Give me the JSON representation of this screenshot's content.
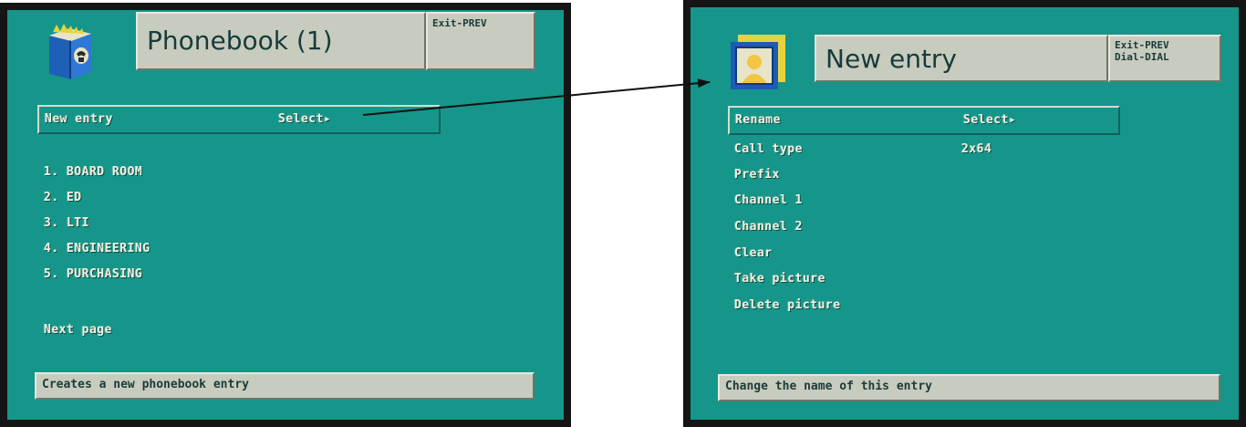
{
  "left_screen": {
    "title": "Phonebook (1)",
    "keys": [
      "Exit-PREV"
    ],
    "selected_item": {
      "label": "New entry",
      "action": "Select▸"
    },
    "entries": [
      "1. BOARD ROOM",
      "2. ED",
      "3. LTI",
      "4. ENGINEERING",
      "5. PURCHASING"
    ],
    "next_page": "Next page",
    "status": "Creates a new phonebook entry"
  },
  "right_screen": {
    "title": "New entry",
    "keys": [
      "Exit-PREV",
      "Dial-DIAL"
    ],
    "items": [
      {
        "label": "Rename",
        "value": "Select▸"
      },
      {
        "label": "Call type",
        "value": "2x64"
      },
      {
        "label": "Prefix",
        "value": ""
      },
      {
        "label": "Channel 1",
        "value": ""
      },
      {
        "label": "Channel 2",
        "value": ""
      },
      {
        "label": "Clear",
        "value": ""
      },
      {
        "label": "Take picture",
        "value": ""
      },
      {
        "label": "Delete picture",
        "value": ""
      }
    ],
    "status": "Change the name of this entry"
  },
  "colors": {
    "screen_bg": "#16968a",
    "panel": "#c7ccbf",
    "text": "#f2f0df",
    "bezel": "#151515"
  },
  "icons": {
    "left": "phonebook-book-icon",
    "right": "new-entry-portrait-icon",
    "connector": "arrow-icon"
  }
}
